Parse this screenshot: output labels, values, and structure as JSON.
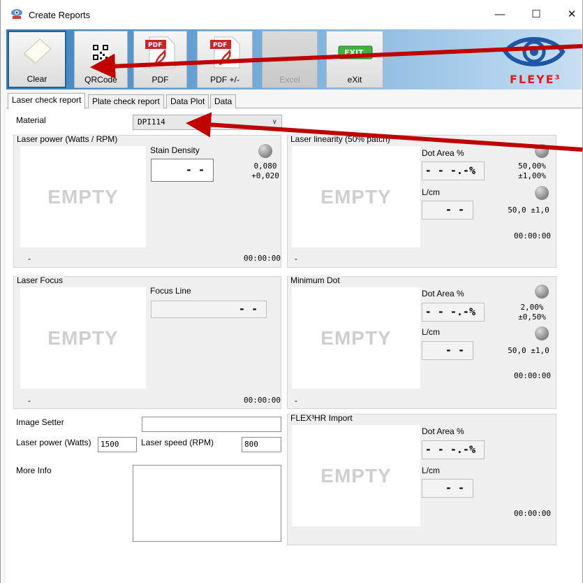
{
  "window": {
    "title": "Create Reports",
    "min_glyph": "—",
    "max_glyph": "☐",
    "close_glyph": "✕"
  },
  "toolbar": {
    "buttons": [
      {
        "label": "Clear",
        "icon": "clear-icon"
      },
      {
        "label": "QRCode",
        "icon": "qr-code-icon"
      },
      {
        "label": "PDF",
        "icon": "pdf-icon"
      },
      {
        "label": "PDF +/-",
        "icon": "pdf-icon"
      },
      {
        "label": "Excel",
        "icon": "excel-icon"
      },
      {
        "label": "eXit",
        "icon": "exit-icon"
      }
    ],
    "pdf_badge": "PDF",
    "exit_badge": "EXIT",
    "logo_text": "FLEYE³"
  },
  "tabs": [
    "Laser check report",
    "Plate check report",
    "Data Plot",
    "Data"
  ],
  "material": {
    "label": "Material",
    "value": "DPI114"
  },
  "laser_power": {
    "title": "Laser power (Watts / RPM)",
    "empty": "EMPTY",
    "stain_label": "Stain Density",
    "stain_value": "- -",
    "target": "0,080",
    "tolerance": "+0,020",
    "dash": "-",
    "time": "00:00:00"
  },
  "laser_linearity": {
    "title": "Laser linearity (50% patch)",
    "empty": "EMPTY",
    "dot_area_label": "Dot Area %",
    "dot_area_value": "- - -.-%",
    "dot_target": "50,00%",
    "dot_tol": "±1,00%",
    "lcm_label": "L/cm",
    "lcm_value": "- -",
    "lcm_target": "50,0 ±1,0",
    "dash": "-",
    "time": "00:00:00"
  },
  "laser_focus": {
    "title": "Laser Focus",
    "empty": "EMPTY",
    "focus_label": "Focus Line",
    "focus_value": "- -",
    "dash": "-",
    "time": "00:00:00"
  },
  "minimum_dot": {
    "title": "Minimum Dot",
    "empty": "EMPTY",
    "dot_area_label": "Dot Area %",
    "dot_area_value": "- - -.-%",
    "dot_target": "2,00%",
    "dot_tol": "±0,50%",
    "lcm_label": "L/cm",
    "lcm_value": "- -",
    "lcm_target": "50,0 ±1,0",
    "dash": "-",
    "time": "00:00:00"
  },
  "flex_import": {
    "title": "FLEX³HR Import",
    "empty": "EMPTY",
    "dot_area_label": "Dot Area %",
    "dot_area_value": "- - -.-%",
    "lcm_label": "L/cm",
    "lcm_value": "- -",
    "time": "00:00:00"
  },
  "settings": {
    "image_setter_label": "Image Setter",
    "image_setter_value": "",
    "laser_power_label": "Laser power (Watts)",
    "laser_power_value": "1500",
    "laser_speed_label": "Laser speed (RPM)",
    "laser_speed_value": "800",
    "more_info_label": "More Info",
    "more_info_value": ""
  },
  "colors": {
    "arrow": "#c00000",
    "accent_blue": "#3a7fb9",
    "logo_red": "#e01b1b"
  }
}
